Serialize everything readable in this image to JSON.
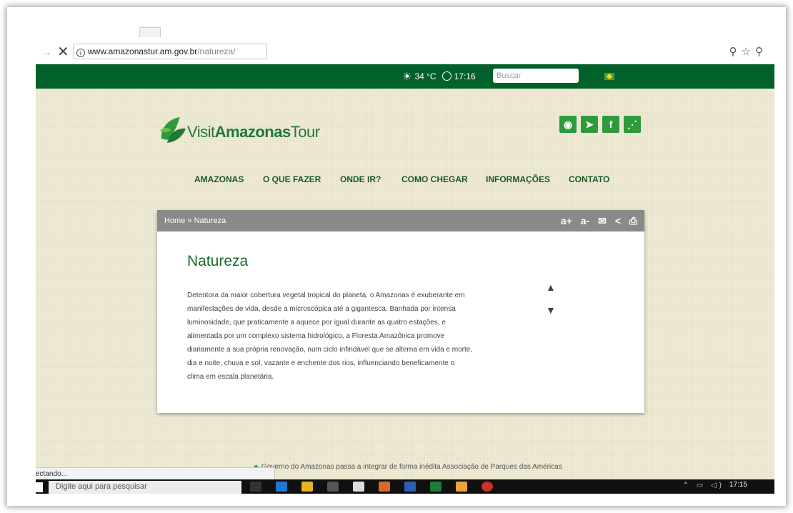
{
  "browser": {
    "url_domain": "www.amazonastur.am.gov.br",
    "url_path": "/natureza/",
    "info_glyph": "i",
    "forward_icon": "→",
    "stop_icon": "✕",
    "right_icons": "⚲ ☆ ⚲"
  },
  "topbar": {
    "temperature": "34 °C",
    "time": "17:16",
    "search_placeholder": "Buscar"
  },
  "logo": {
    "visit": "Visit",
    "amazonas": "Amazonas",
    "tour": "Tour"
  },
  "social": [
    {
      "name": "instagram-icon",
      "glyph": "◉"
    },
    {
      "name": "twitter-icon",
      "glyph": "➤"
    },
    {
      "name": "facebook-icon",
      "glyph": "f"
    },
    {
      "name": "rss-icon",
      "glyph": "⋰"
    }
  ],
  "nav": {
    "items": [
      "AMAZONAS",
      "O QUE FAZER",
      "ONDE IR?",
      "COMO CHEGAR",
      "INFORMAÇÕES",
      "CONTATO"
    ]
  },
  "breadcrumb": {
    "text": "Home » Natureza"
  },
  "tools": {
    "font_increase": "a+",
    "font_decrease": "a-",
    "email": "✉",
    "share": "<",
    "print": "⎙"
  },
  "article": {
    "title": "Natureza",
    "body": "Detentora da maior cobertura vegetal tropical do planeta, o Amazonas é exuberante em manifestações de vida, desde a microscópica até a gigantesca. Banhada por intensa luminosidade, que praticamente a aquece por igual durante as quatro estações, e alimentada por um complexo sistema hidrológico, a Floresta Amazônica promove diariamente a sua própria renovação, num ciclo infindável que se alterna em vida e morte, dia e noite, chuva e sol, vazante e enchente dos rios, influenciando beneficamente o clima em escala planetária.",
    "up_arrow": "▲",
    "down_arrow": "▼"
  },
  "ticker": {
    "bullet": "◆",
    "text": "Governo do Amazonas passa a integrar de forma inédita Associação de Parques das Américas"
  },
  "status": {
    "loading": "ectando..."
  },
  "taskbar": {
    "search_text": "Digite aqui para pesquisar",
    "clock": "17:15"
  }
}
